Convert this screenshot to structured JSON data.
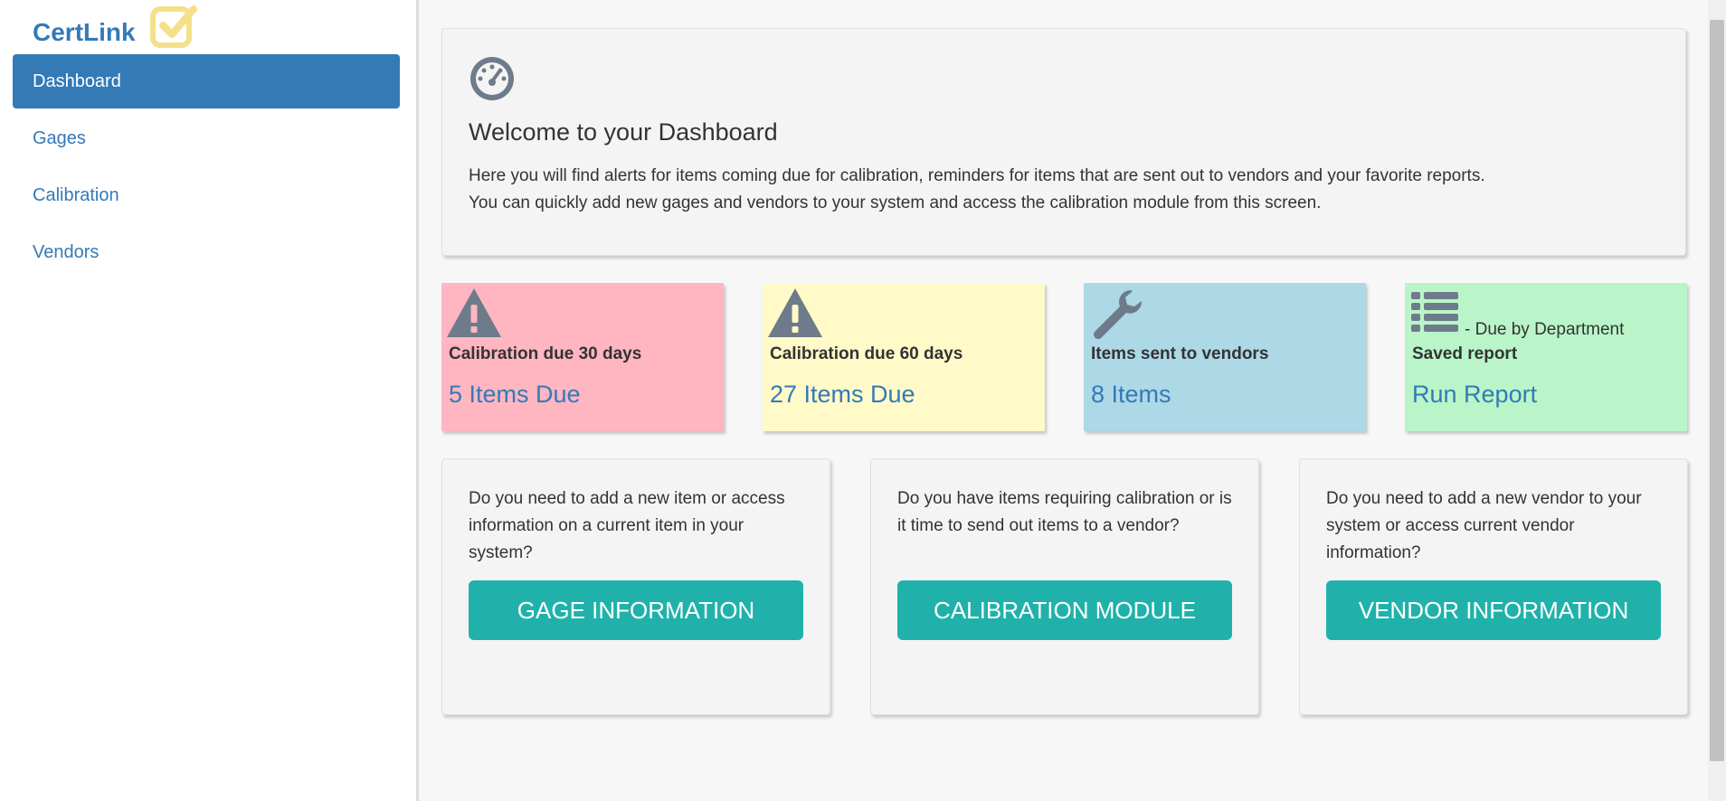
{
  "app": {
    "brand": "CertLink"
  },
  "sidebar": {
    "items": [
      {
        "label": "Dashboard",
        "active": true
      },
      {
        "label": "Gages"
      },
      {
        "label": "Calibration"
      },
      {
        "label": "Vendors"
      }
    ]
  },
  "welcome": {
    "title": "Welcome to your Dashboard",
    "line1": "Here you will find alerts for items coming due for calibration, reminders for items that are sent out to vendors and your favorite reports.",
    "line2": "You can quickly add new gages and vendors to your system and access the calibration module from this screen."
  },
  "cards": [
    {
      "caption": "Calibration due 30 days",
      "link": "5 Items Due",
      "icon": "warning-icon",
      "color": "#ffb6c1"
    },
    {
      "caption": "Calibration due 60 days",
      "link": "27 Items Due",
      "icon": "warning-icon",
      "color": "#fffac8"
    },
    {
      "caption": "Items sent to vendors",
      "link": "8 Items",
      "icon": "wrench-icon",
      "color": "#add8e6"
    },
    {
      "caption": "Saved report",
      "sub": "- Due by Department",
      "link": "Run Report",
      "icon": "list-icon",
      "color": "#b9f5c8"
    }
  ],
  "panels": [
    {
      "text": "Do you need to add a new item or access information on a current item in your system?",
      "button": "GAGE INFORMATION"
    },
    {
      "text": "Do you have items requiring calibration or is it time to send out items to a vendor?",
      "button": "CALIBRATION MODULE"
    },
    {
      "text": "Do you need to add a new vendor to your system or access current vendor information?",
      "button": "VENDOR INFORMATION"
    }
  ],
  "colors": {
    "primary": "#337ab7",
    "accent_button": "#20b2aa",
    "icon_gray": "#6e7b8b"
  }
}
